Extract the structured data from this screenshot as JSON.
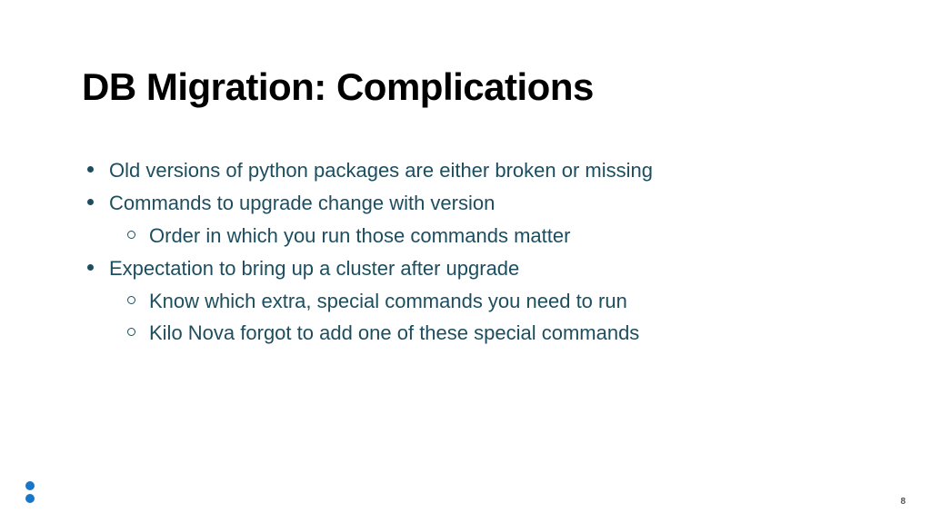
{
  "title": "DB Migration: Complications",
  "bullets": {
    "b0": "Old versions of python packages are either broken or missing",
    "b1": "Commands to upgrade change with version",
    "b1_0": "Order in which you run those commands matter",
    "b2": "Expectation to bring up a cluster after upgrade",
    "b2_0": "Know which extra, special commands you need to run",
    "b2_1": "Kilo Nova forgot to add one of these special commands"
  },
  "page_number": "8"
}
